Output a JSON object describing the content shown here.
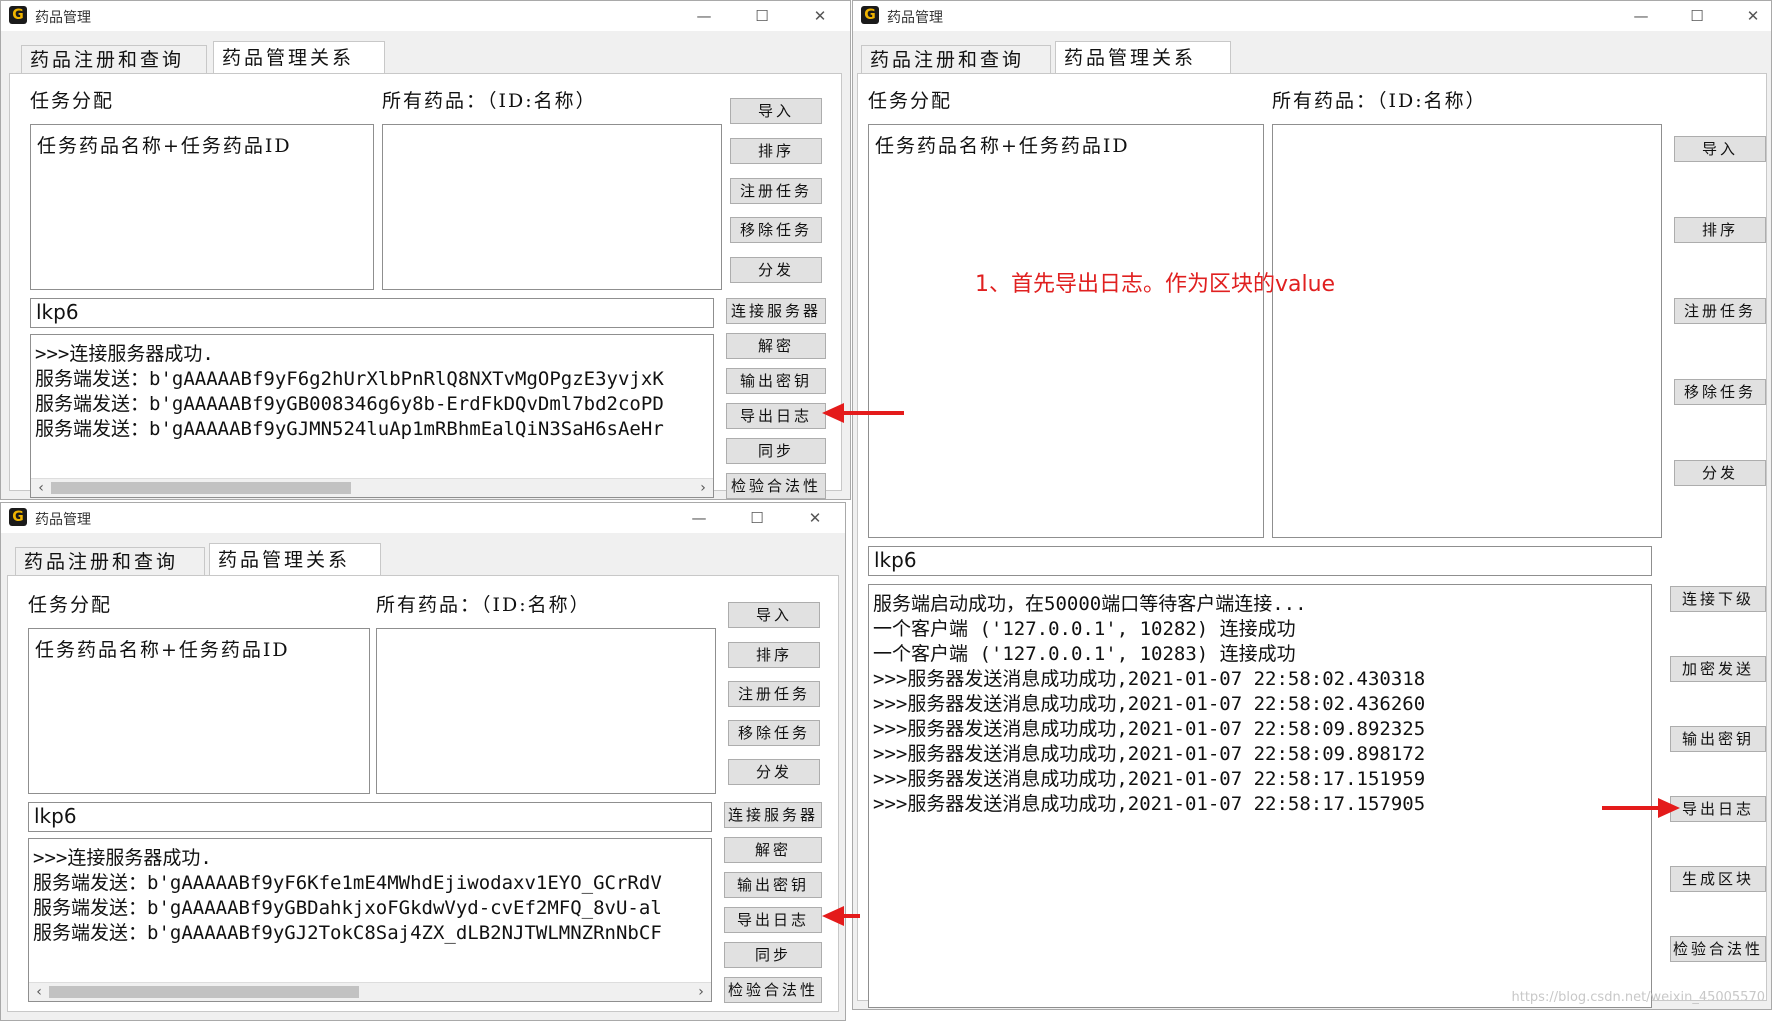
{
  "app": {
    "title": "药品管理",
    "icon_glyph": "G"
  },
  "window_controls": {
    "minimize": "—",
    "maximize": "☐",
    "close": "✕"
  },
  "tabs": [
    "药品注册和查询",
    "药品管理关系"
  ],
  "labels": {
    "assign": "任务分配",
    "all_drugs": "所有药品：（ID:名称）",
    "task_list_item": "任务药品名称+任务药品ID"
  },
  "clients": [
    {
      "entry_value": "lkp6",
      "log": [
        ">>>连接服务器成功.",
        "服务端发送：b'gAAAAABf9yF6g2hUrXlbPnRlQ8NXTvMgOPgzE3yvjxK",
        "服务端发送：b'gAAAAABf9yGB008346g6y8b-ErdFkDQvDml7bd2coPD",
        "服务端发送：b'gAAAAABf9yGJMN524luAp1mRBhmEalQiN3SaH6sAeHr"
      ]
    },
    {
      "entry_value": "lkp6",
      "log": [
        ">>>连接服务器成功.",
        "服务端发送：b'gAAAAABf9yF6Kfe1mE4MWhdEjiwodaxv1EYO_GCrRdV",
        "服务端发送：b'gAAAAABf9yGBDahkjxoFGkdwVyd-cvEf2MFQ_8vU-al",
        "服务端发送：b'gAAAAABf9yGJ2TokC8Saj4ZX_dLB2NJTWLMNZRnNbCF"
      ]
    }
  ],
  "client_buttons": [
    "导入",
    "排序",
    "注册任务",
    "移除任务",
    "分发",
    "连接服务器",
    "解密",
    "输出密钥",
    "导出日志",
    "同步",
    "检验合法性"
  ],
  "server": {
    "entry_value": "lkp6",
    "top_buttons": [
      "导入",
      "排序",
      "注册任务",
      "移除任务",
      "分发"
    ],
    "bottom_buttons": [
      "连接下级",
      "加密发送",
      "输出密钥",
      "导出日志",
      "生成区块",
      "检验合法性"
    ],
    "log": [
      "服务端启动成功，在50000端口等待客户端连接...",
      "一个客户端 ('127.0.0.1', 10282) 连接成功",
      "一个客户端 ('127.0.0.1', 10283) 连接成功",
      ">>>服务器发送消息成功成功,2021-01-07 22:58:02.430318",
      ">>>服务器发送消息成功成功,2021-01-07 22:58:02.436260",
      ">>>服务器发送消息成功成功,2021-01-07 22:58:09.892325",
      ">>>服务器发送消息成功成功,2021-01-07 22:58:09.898172",
      ">>>服务器发送消息成功成功,2021-01-07 22:58:17.151959",
      ">>>服务器发送消息成功成功,2021-01-07 22:58:17.157905"
    ]
  },
  "annotation": "1、首先导出日志。作为区块的value",
  "watermark": "https://blog.csdn.net/weixin_45005570",
  "colors": {
    "annotation": "#e02020",
    "arrow": "#e41b1b",
    "window_bg": "#f0f0f0"
  }
}
